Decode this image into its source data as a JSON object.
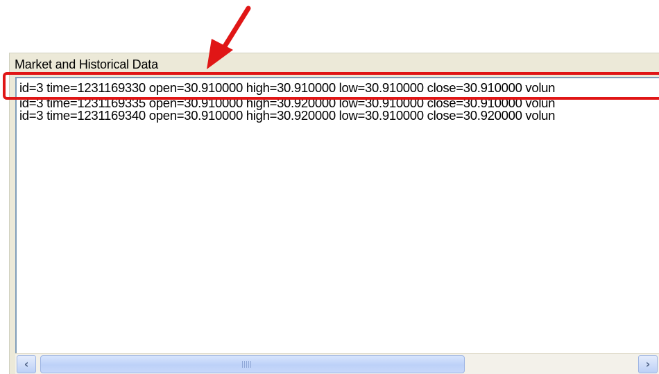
{
  "group": {
    "title": "Market and Historical Data"
  },
  "rows": [
    "id=3 time=1231169330 open=30.910000 high=30.910000 low=30.910000 close=30.910000 volun",
    "id=3 time=1231169335 open=30.910000 high=30.920000 low=30.910000 close=30.910000 volun",
    "id=3 time=1231169340 open=30.910000 high=30.920000 low=30.910000 close=30.920000 volun"
  ],
  "scrollbar": {
    "left_icon": "‹",
    "right_icon": "›"
  },
  "annotation": {
    "highlight_color": "#e01616",
    "arrow_icon": "arrow-icon"
  }
}
